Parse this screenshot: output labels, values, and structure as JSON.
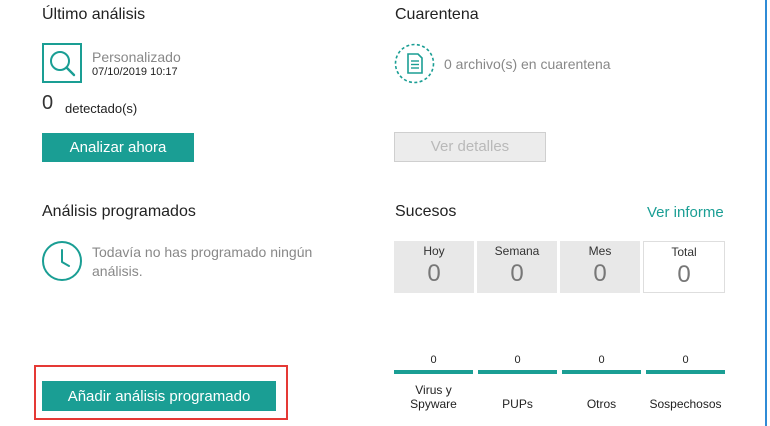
{
  "last_scan": {
    "title": "Último análisis",
    "type": "Personalizado",
    "date": "07/10/2019 10:17",
    "detected_count": "0",
    "detected_label": "detectado(s)",
    "scan_button": "Analizar ahora"
  },
  "quarantine": {
    "title": "Cuarentena",
    "status": "0 archivo(s) en cuarentena",
    "details_button": "Ver detalles"
  },
  "scheduled": {
    "title": "Análisis programados",
    "empty_message": "Todavía no has programado ningún análisis.",
    "add_button": "Añadir análisis programado"
  },
  "events": {
    "title": "Sucesos",
    "report_link": "Ver informe",
    "periods": [
      {
        "label": "Hoy",
        "value": "0"
      },
      {
        "label": "Semana",
        "value": "0"
      },
      {
        "label": "Mes",
        "value": "0"
      },
      {
        "label": "Total",
        "value": "0"
      }
    ],
    "categories": [
      {
        "label": "Virus y Spyware",
        "count": "0"
      },
      {
        "label": "PUPs",
        "count": "0"
      },
      {
        "label": "Otros",
        "count": "0"
      },
      {
        "label": "Sospechosos",
        "count": "0"
      }
    ]
  },
  "colors": {
    "accent": "#1a9e94",
    "highlight_frame": "#e53935"
  },
  "icons": {
    "scan": "magnifier-icon",
    "quarantine": "document-icon",
    "schedule": "clock-icon"
  }
}
